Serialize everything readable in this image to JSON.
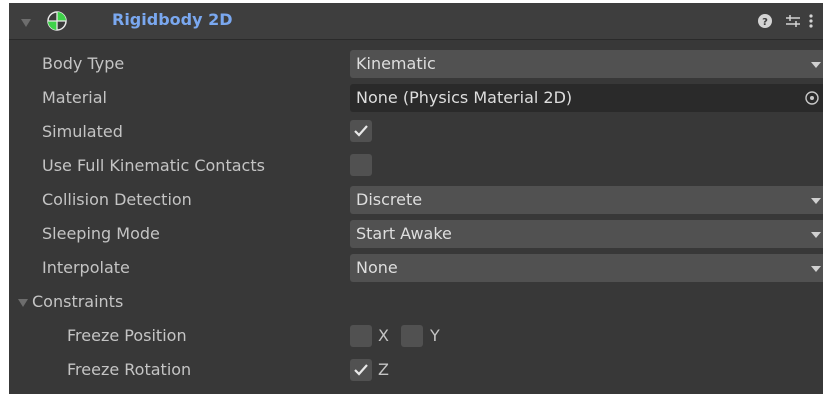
{
  "component": {
    "title": "Rigidbody 2D",
    "enabled": true,
    "icons": [
      "help-icon",
      "presets-icon",
      "more-options-icon"
    ]
  },
  "properties": {
    "body_type": {
      "label": "Body Type",
      "value": "Kinematic"
    },
    "material": {
      "label": "Material",
      "value": "None (Physics Material 2D)"
    },
    "simulated": {
      "label": "Simulated",
      "checked": true
    },
    "use_full_kinematic_contacts": {
      "label": "Use Full Kinematic Contacts",
      "checked": false
    },
    "collision_detection": {
      "label": "Collision Detection",
      "value": "Discrete"
    },
    "sleeping_mode": {
      "label": "Sleeping Mode",
      "value": "Start Awake"
    },
    "interpolate": {
      "label": "Interpolate",
      "value": "None"
    }
  },
  "constraints": {
    "label": "Constraints",
    "freeze_position": {
      "label": "Freeze Position",
      "x_label": "X",
      "y_label": "Y",
      "x": false,
      "y": false
    },
    "freeze_rotation": {
      "label": "Freeze Rotation",
      "z_label": "Z",
      "z": true
    }
  },
  "colors": {
    "background": "#383838",
    "header": "#3e3e3e",
    "title": "#7aa8f0",
    "field": "#515151",
    "object_field": "#2a2a2a",
    "text": "#c4c4c4"
  }
}
